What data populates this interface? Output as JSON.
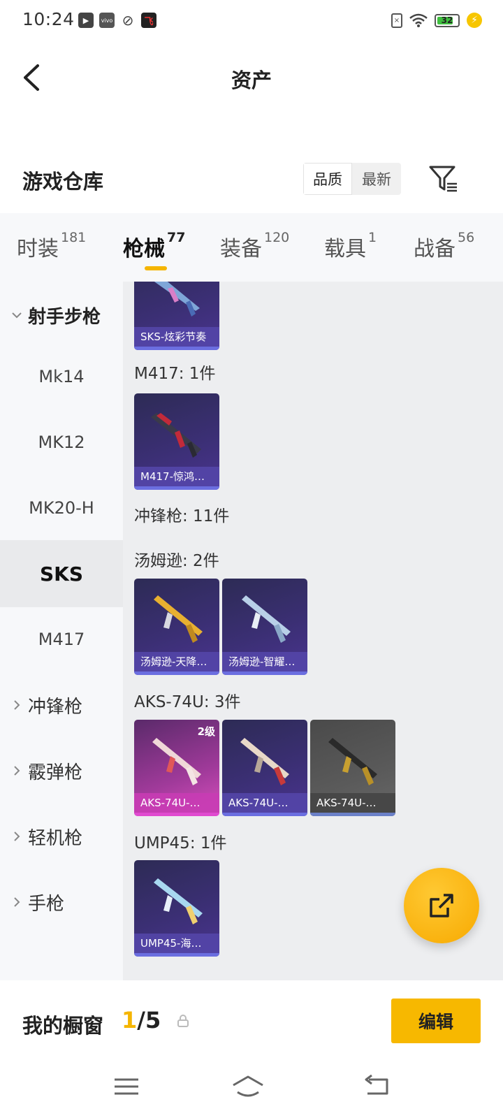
{
  "status_bar": {
    "time": "10:24",
    "left_icons": [
      "play-icon",
      "vivo-icon",
      "leaf-icon",
      "app-icon"
    ],
    "battery_level": "32"
  },
  "header": {
    "title": "资产"
  },
  "warehouse": {
    "title": "游戏仓库",
    "sort_options": [
      "品质",
      "最新"
    ],
    "sort_selected": "品质"
  },
  "tabs": [
    {
      "label": "时装",
      "count": "181",
      "active": false
    },
    {
      "label": "枪械",
      "count": "77",
      "active": true
    },
    {
      "label": "装备",
      "count": "120",
      "active": false
    },
    {
      "label": "载具",
      "count": "1",
      "active": false
    },
    {
      "label": "战备",
      "count": "56",
      "active": false
    }
  ],
  "sidebar": {
    "items": [
      {
        "label": "射手步枪",
        "type": "group",
        "expanded": true
      },
      {
        "label": "Mk14",
        "type": "sub"
      },
      {
        "label": "MK12",
        "type": "sub"
      },
      {
        "label": "MK20-H",
        "type": "sub"
      },
      {
        "label": "SKS",
        "type": "sub",
        "selected": true
      },
      {
        "label": "M417",
        "type": "sub"
      },
      {
        "label": "冲锋枪",
        "type": "group",
        "expanded": false
      },
      {
        "label": "霰弹枪",
        "type": "group",
        "expanded": false
      },
      {
        "label": "轻机枪",
        "type": "group",
        "expanded": false
      },
      {
        "label": "手枪",
        "type": "group",
        "expanded": false
      }
    ]
  },
  "content": {
    "top_card": {
      "name": "SKS-炫彩节奏"
    },
    "sections": [
      {
        "label": "M417: 1件",
        "cards": [
          {
            "name": "M417-惊鸿…"
          }
        ]
      },
      {
        "label": "冲锋枪: 11件"
      },
      {
        "label": "汤姆逊: 2件",
        "cards": [
          {
            "name": "汤姆逊-天降…"
          },
          {
            "name": "汤姆逊-智耀…"
          }
        ]
      },
      {
        "label": "AKS-74U: 3件",
        "cards": [
          {
            "name": "AKS-74U-…",
            "level": "2级"
          },
          {
            "name": "AKS-74U-…"
          },
          {
            "name": "AKS-74U-…"
          }
        ]
      },
      {
        "label": "UMP45: 1件",
        "cards": [
          {
            "name": "UMP45-海…"
          }
        ]
      }
    ]
  },
  "showcase": {
    "label": "我的橱窗",
    "current": "1",
    "total": "/5",
    "edit_label": "编辑"
  },
  "colors": {
    "accent": "#f7b800",
    "card_purple": "#3b2f74",
    "card_pink": "#d94fbe",
    "card_gray": "#5a5a5a"
  }
}
